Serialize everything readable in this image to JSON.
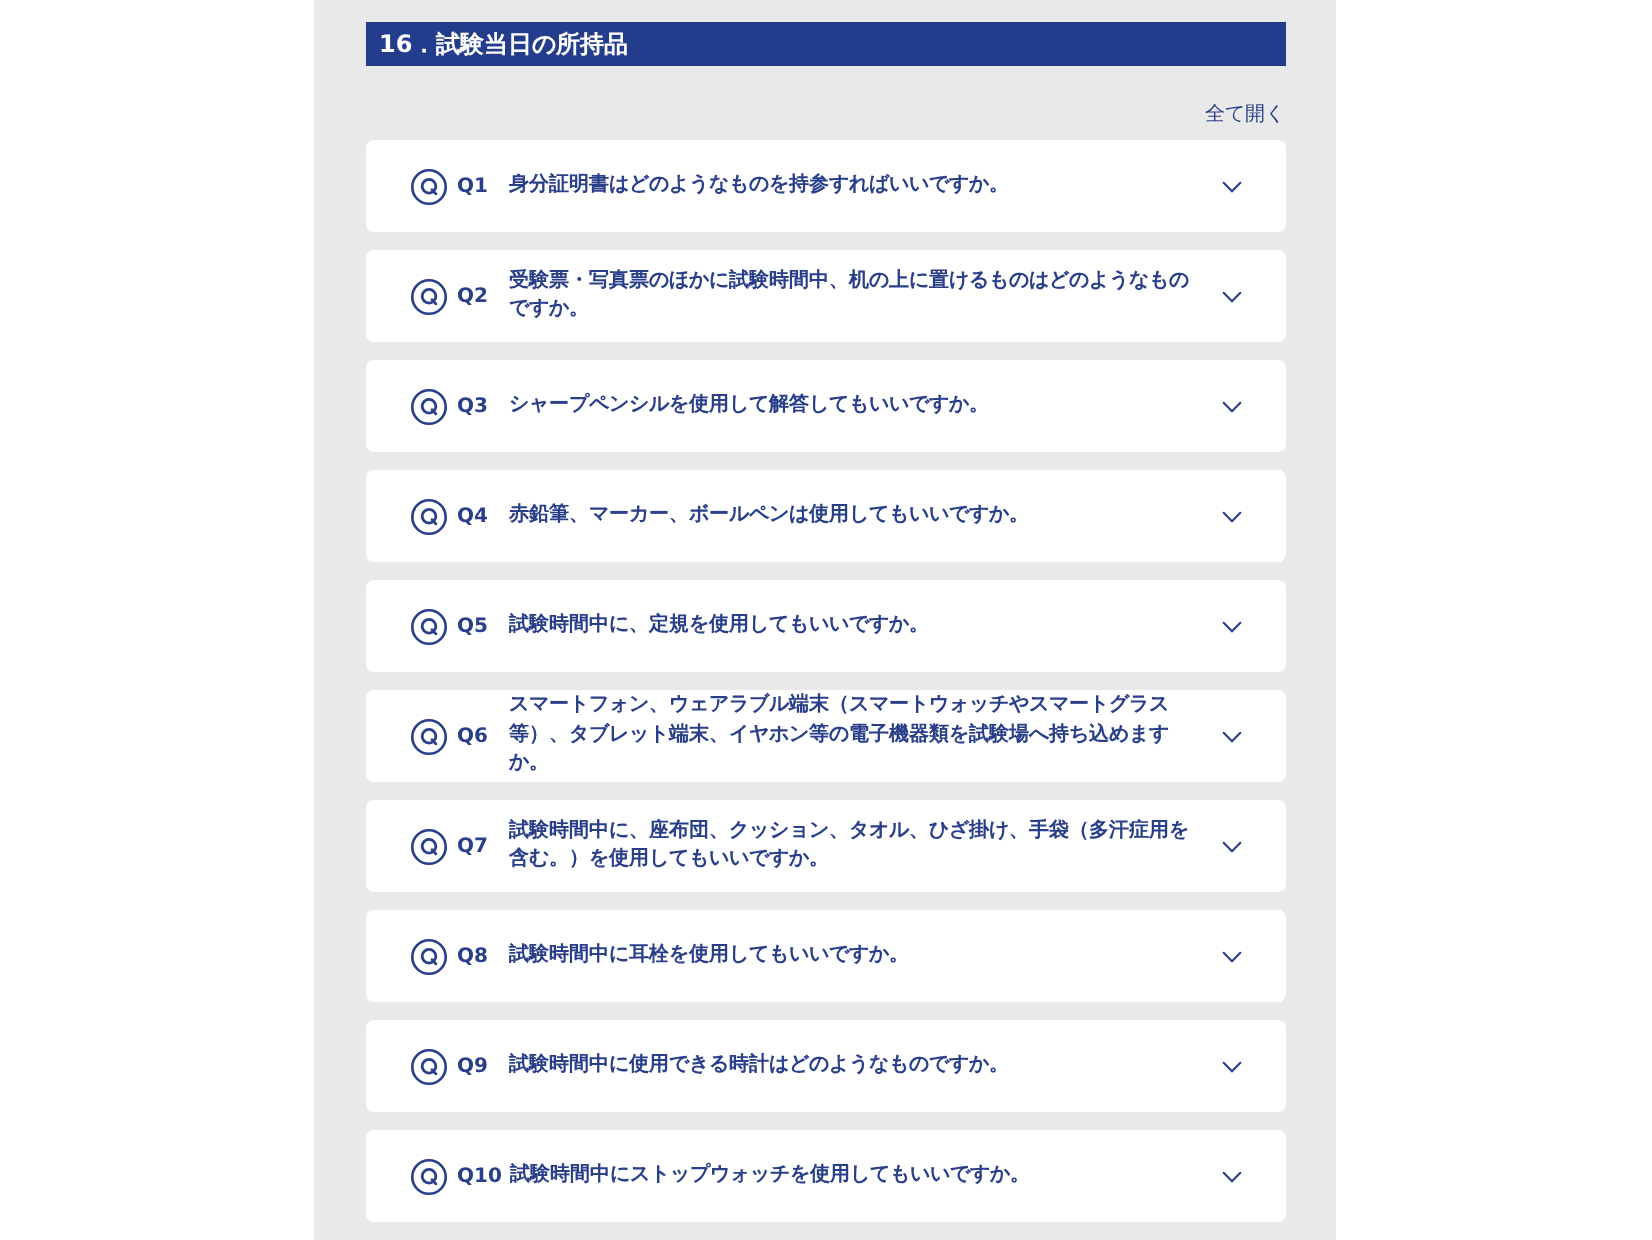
{
  "section": {
    "title": "16．試験当日の所持品",
    "expand_all": "全て開く"
  },
  "faq": [
    {
      "number": "Q1",
      "question": "身分証明書はどのようなものを持参すればいいですか。",
      "expanded": false
    },
    {
      "number": "Q2",
      "question": "受験票・写真票のほかに試験時間中、机の上に置けるものはどのようなものですか。",
      "expanded": false
    },
    {
      "number": "Q3",
      "question": "シャープペンシルを使用して解答してもいいですか。",
      "expanded": false
    },
    {
      "number": "Q4",
      "question": "赤鉛筆、マーカー、ボールペンは使用してもいいですか。",
      "expanded": false
    },
    {
      "number": "Q5",
      "question": "試験時間中に、定規を使用してもいいですか。",
      "expanded": false
    },
    {
      "number": "Q6",
      "question": "スマートフォン、ウェアラブル端末（スマートウォッチやスマートグラス等）、タブレット端末、イヤホン等の電子機器類を試験場へ持ち込めますか。",
      "expanded": false
    },
    {
      "number": "Q7",
      "question": "試験時間中に、座布団、クッション、タオル、ひざ掛け、手袋（多汗症用を含む。）を使用してもいいですか。",
      "expanded": false
    },
    {
      "number": "Q8",
      "question": "試験時間中に耳栓を使用してもいいですか。",
      "expanded": false
    },
    {
      "number": "Q9",
      "question": "試験時間中に使用できる時計はどのようなものですか。",
      "expanded": false
    },
    {
      "number": "Q10",
      "question": "試験時間中にストップウォッチを使用してもいいですか。",
      "expanded": false
    }
  ]
}
